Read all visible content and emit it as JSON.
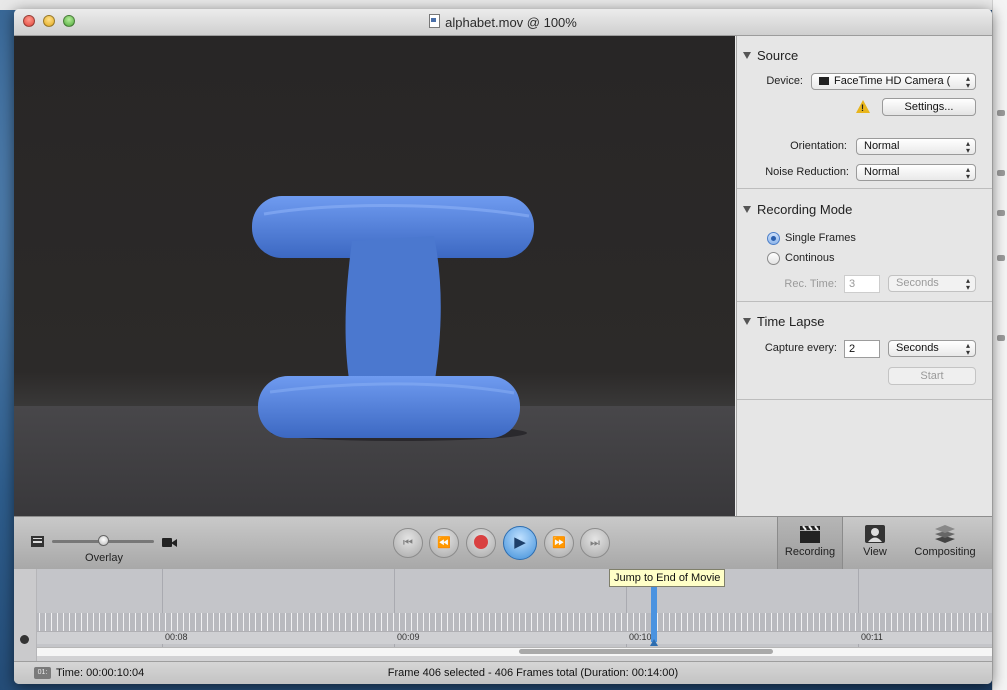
{
  "window": {
    "title": "alphabet.mov @ 100%"
  },
  "source": {
    "heading": "Source",
    "device_label": "Device:",
    "device_value": "FaceTime HD Camera (",
    "settings_button": "Settings...",
    "orientation_label": "Orientation:",
    "orientation_value": "Normal",
    "noise_label": "Noise Reduction:",
    "noise_value": "Normal"
  },
  "recording_mode": {
    "heading": "Recording Mode",
    "option_single": "Single Frames",
    "option_continuous": "Continous",
    "selected": "Single Frames",
    "rec_time_label": "Rec. Time:",
    "rec_time_value": "3",
    "rec_time_unit": "Seconds"
  },
  "time_lapse": {
    "heading": "Time Lapse",
    "capture_label": "Capture every:",
    "capture_value": "2",
    "capture_unit": "Seconds",
    "start_button": "Start"
  },
  "controls": {
    "overlay_label": "Overlay",
    "overlay_value": 0.5,
    "tabs": [
      {
        "label": "Recording",
        "selected": true
      },
      {
        "label": "View",
        "selected": false
      },
      {
        "label": "Compositing",
        "selected": false
      }
    ]
  },
  "timeline": {
    "tooltip": "Jump to End of Movie",
    "ticks": [
      "00:08",
      "00:09",
      "00:10",
      "00:11"
    ]
  },
  "status": {
    "icon_text": "01:",
    "time": "Time: 00:00:10:04",
    "frames": "Frame 406 selected - 406 Frames total (Duration: 00:14:00)"
  },
  "colors": {
    "accent": "#3f8fd9",
    "clay": "#4f7fd4",
    "record": "#d94040"
  }
}
